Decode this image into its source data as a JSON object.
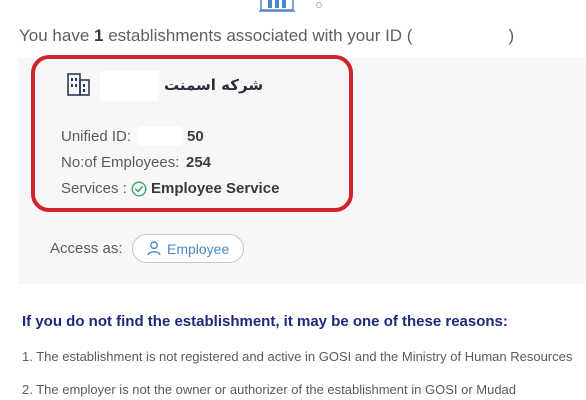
{
  "header": {
    "prefix": "You have",
    "count": "1",
    "suffix": "establishments associated with your ID (",
    "close_paren": ")"
  },
  "establishment": {
    "name": "شركه اسمنت",
    "fields": [
      {
        "label": "Unified ID:",
        "value": "50"
      },
      {
        "label": "No:of Employees:",
        "value": "254"
      }
    ],
    "services_label": "Services :",
    "service_value": "Employee Service"
  },
  "access": {
    "label": "Access as:",
    "button_label": "Employee"
  },
  "reasons": {
    "title": "If you do not find the establishment, it may be one of these reasons:",
    "items": [
      "1. The establishment is not registered and active in GOSI and the Ministry of Human Resources",
      "2. The employer is not the owner or authorizer of the establishment in GOSI or Mudad"
    ]
  },
  "icons": [
    "building-icon",
    "company-building-icon",
    "check-circle-icon",
    "user-icon"
  ],
  "colors": {
    "highlight": "#d0232b",
    "accent": "#4e86c6",
    "success": "#3aa36b",
    "heading": "#1d2a7a"
  }
}
